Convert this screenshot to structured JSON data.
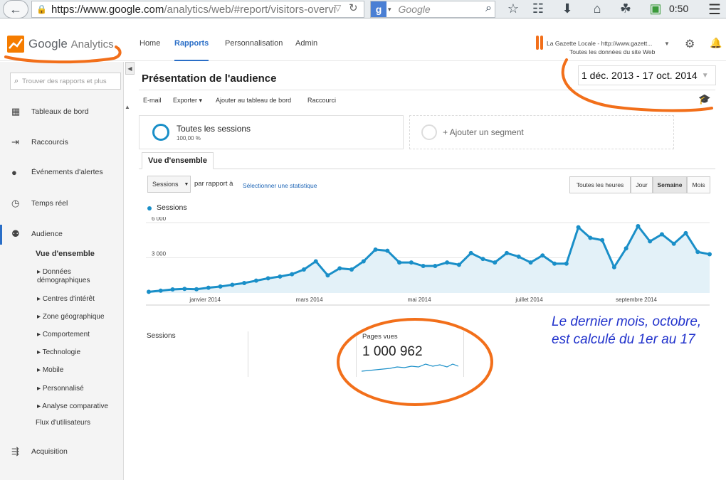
{
  "browser": {
    "url_host": "https://www.google.com",
    "url_path": "/analytics/web/#report/visitors-overvi",
    "search_placeholder": "Google",
    "clock": "0:50"
  },
  "header": {
    "logo_google": "Google",
    "logo_product": "Analytics",
    "nav": [
      "Home",
      "Rapports",
      "Personnalisation",
      "Admin"
    ],
    "active_nav": "Rapports",
    "account_name": "La Gazette Locale - http://www.gazett...",
    "account_view": "Toutes les données du site Web"
  },
  "sidebar": {
    "search_placeholder": "Trouver des rapports et plus",
    "items": [
      {
        "label": "Tableaux de bord",
        "icon": "grid-icon"
      },
      {
        "label": "Raccourcis",
        "icon": "shortcut-arrows-icon"
      },
      {
        "label": "Événements d'alertes",
        "icon": "lightbulb-icon"
      },
      {
        "label": "Temps réel",
        "icon": "clock-icon"
      },
      {
        "label": "Audience",
        "icon": "people-icon"
      },
      {
        "label": "Acquisition",
        "icon": "acquisition-arrow-icon"
      }
    ],
    "audience_overview": "Vue d'ensemble",
    "audience_sub": [
      "Données démographiques",
      "Centres d'intérêt",
      "Zone géographique",
      "Comportement",
      "Technologie",
      "Mobile",
      "Personnalisé",
      "Analyse comparative"
    ],
    "user_flow": "Flux d'utilisateurs"
  },
  "main": {
    "title": "Présentation de l'audience",
    "date_range": "1 déc. 2013 - 17 oct. 2014",
    "toolbar": [
      "E-mail",
      "Exporter",
      "Ajouter au tableau de bord",
      "Raccourci"
    ],
    "segment_name": "Toutes les sessions",
    "segment_pct": "100,00 %",
    "add_segment": "+ Ajouter un segment",
    "tab": "Vue d'ensemble",
    "metric_select": "Sessions",
    "compare_label": "par rapport à",
    "select_stat": "Sélectionner une statistique",
    "granularity": [
      "Toutes les heures",
      "Jour",
      "Semaine",
      "Mois"
    ],
    "active_granularity": "Semaine",
    "sessions_label": "Sessions",
    "pageviews_label": "Pages vues",
    "pageviews_value": "1 000 962"
  },
  "annotation": {
    "line1": "Le dernier mois, octobre,",
    "line2": "est calculé du 1er au 17"
  },
  "colors": {
    "series": "#1a8fc8",
    "area": "#e3f1f8",
    "annotation_ink": "#f26f1a",
    "annotation_text": "#2233cc"
  },
  "chart_data": {
    "type": "area",
    "series": [
      {
        "name": "Sessions",
        "values": [
          100,
          200,
          300,
          350,
          320,
          450,
          550,
          700,
          850,
          1050,
          1250,
          1400,
          1600,
          2000,
          2700,
          1500,
          2100,
          2000,
          2700,
          3700,
          3600,
          2600,
          2600,
          2300,
          2300,
          2600,
          2400,
          3400,
          2900,
          2600,
          3400,
          3100,
          2600,
          3200,
          2500,
          2500,
          5600,
          4700,
          4500,
          2200,
          3800,
          5700,
          4400,
          5000,
          4200,
          5100,
          3500,
          3300
        ]
      }
    ],
    "x_tick_labels": [
      "janvier 2014",
      "mars 2014",
      "mai 2014",
      "juillet 2014",
      "septembre 2014"
    ],
    "y_tick_labels": [
      "6 000",
      "3 000"
    ],
    "ylim": [
      0,
      6000
    ],
    "grid": true,
    "legend": "top-left"
  }
}
